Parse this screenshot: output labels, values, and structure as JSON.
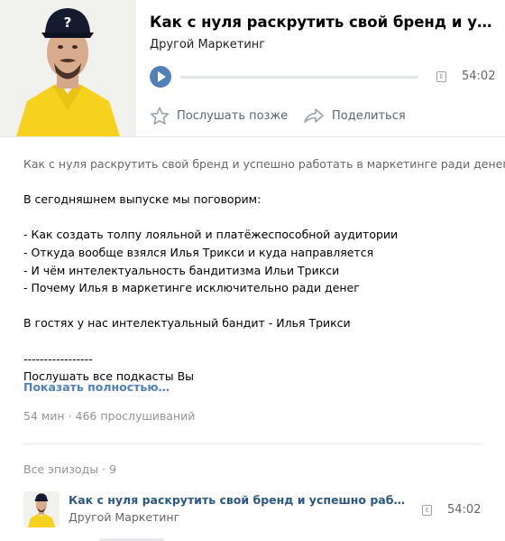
{
  "podcast": {
    "title": "Как с нуля раскрутить свой бренд и успешно работать в маркетинге ради денег?",
    "artist": "Другой Маркетинг",
    "duration": "54:02",
    "explicit_badge": "E",
    "actions": {
      "listen_later": "Послушать позже",
      "share": "Поделиться"
    }
  },
  "description": {
    "lines": [
      "Как с нуля раскрутить свой бренд и успешно работать в маркетинге ради денег?",
      "",
      "В сегодняшнем выпуске мы поговорим:",
      "",
      "- Как создать толпу лояльной и платёжеспособной аудитории",
      "- Откуда вообще взялся Илья Трикси и куда направляется",
      "- И чём интелектуальность бандитизма Ильи Трикси",
      "- Почему Илья в маркетинге исключительно ради денег",
      "",
      "В гостях у нас интелектуальный бандит - Илья Трикси",
      "",
      "-----------------",
      "Послушать все подкасты Вы"
    ],
    "show_more": "Показать полностью…",
    "stats": "54 мин · 466 прослушиваний"
  },
  "episodes": {
    "header": "Все эпизоды · 9",
    "items": [
      {
        "title": "Как с нуля раскрутить свой бренд и успешно работать в ма...",
        "artist": "Другой Маркетинг",
        "duration": "54:02",
        "explicit_badge": "E"
      }
    ]
  },
  "colors": {
    "accent": "#5181b8",
    "link": "#2a5885",
    "muted": "#939393",
    "jacket": "#f6d21f"
  },
  "icons": [
    "play-icon",
    "star-icon",
    "share-arrow-icon",
    "explicit-icon"
  ]
}
